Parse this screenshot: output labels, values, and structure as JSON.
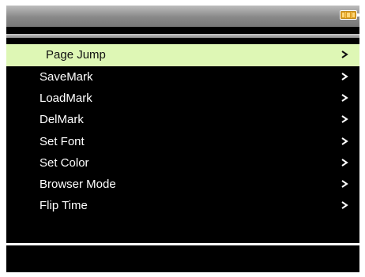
{
  "status_bar": {
    "battery_icon": "battery-icon",
    "battery_level_fraction": 1.0
  },
  "menu": {
    "items": [
      {
        "label": "Page  Jump",
        "icon": "chevron-right-icon",
        "selected": true
      },
      {
        "label": "SaveMark",
        "icon": "chevron-right-icon",
        "selected": false
      },
      {
        "label": "LoadMark",
        "icon": "chevron-right-icon",
        "selected": false
      },
      {
        "label": "DelMark",
        "icon": "chevron-right-icon",
        "selected": false
      },
      {
        "label": "Set Font",
        "icon": "chevron-right-icon",
        "selected": false
      },
      {
        "label": "Set Color",
        "icon": "chevron-right-icon",
        "selected": false
      },
      {
        "label": "Browser Mode",
        "icon": "chevron-right-icon",
        "selected": false
      },
      {
        "label": "Flip Time",
        "icon": "chevron-right-icon",
        "selected": false
      }
    ]
  },
  "colors": {
    "background": "#000000",
    "selection_highlight": "#def7b5",
    "text": "#ffffff",
    "battery": "#f6c34c"
  }
}
